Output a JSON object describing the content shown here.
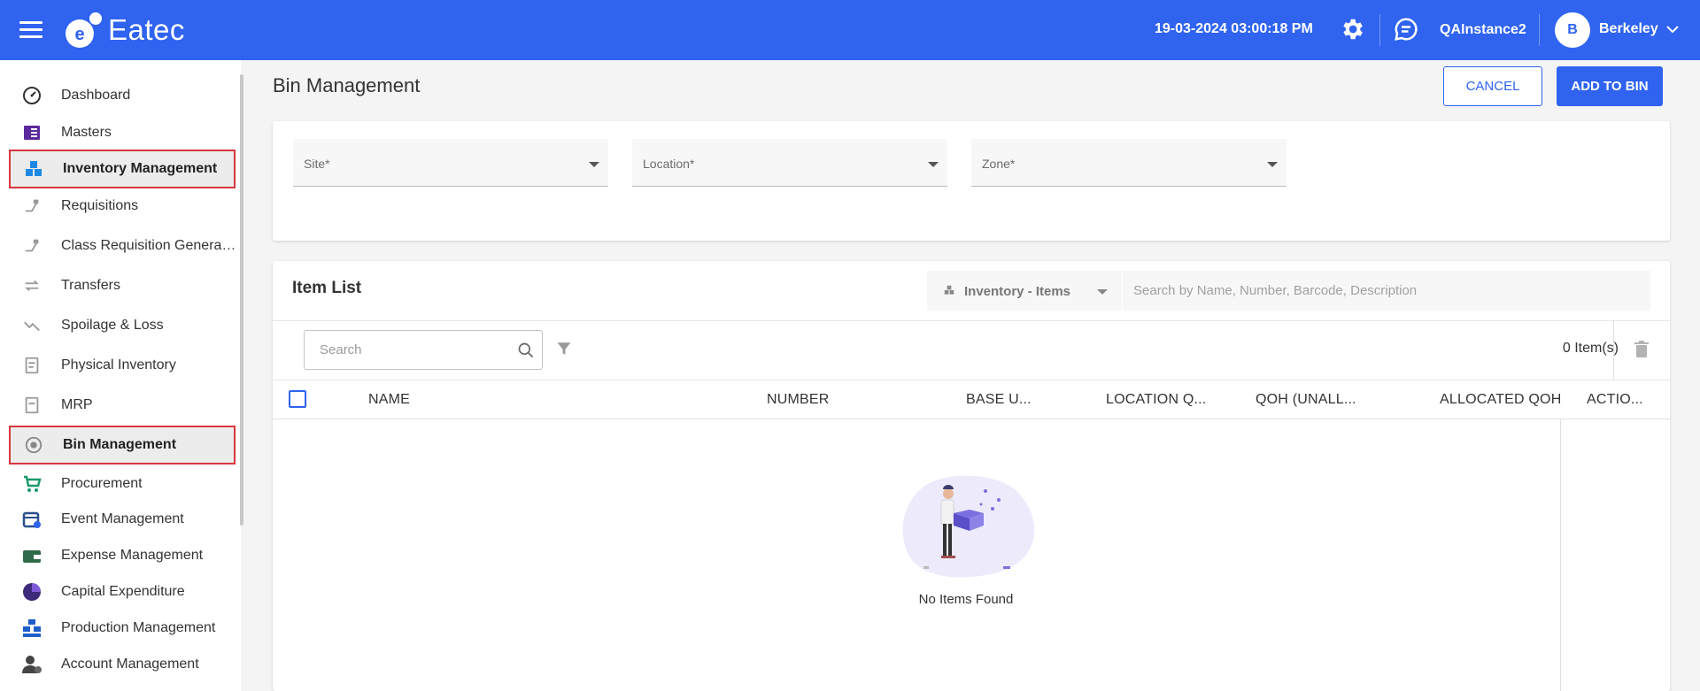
{
  "header": {
    "brand": "Eatec",
    "datetime": "19-03-2024 03:00:18 PM",
    "instance": "QAInstance2",
    "user_initial": "B",
    "user_name": "Berkeley"
  },
  "sidebar": {
    "items": [
      {
        "label": "Dashboard",
        "icon": "dashboard-icon"
      },
      {
        "label": "Masters",
        "icon": "book-icon"
      },
      {
        "label": "Inventory Management",
        "icon": "inventory-icon"
      },
      {
        "label": "Requisitions",
        "icon": "requisition-icon"
      },
      {
        "label": "Class Requisition Generation",
        "icon": "requisition-icon"
      },
      {
        "label": "Transfers",
        "icon": "transfer-icon"
      },
      {
        "label": "Spoilage & Loss",
        "icon": "spoilage-icon"
      },
      {
        "label": "Physical Inventory",
        "icon": "physical-inventory-icon"
      },
      {
        "label": "MRP",
        "icon": "mrp-icon"
      },
      {
        "label": "Bin Management",
        "icon": "bin-icon"
      },
      {
        "label": "Procurement",
        "icon": "cart-icon"
      },
      {
        "label": "Event Management",
        "icon": "calendar-icon"
      },
      {
        "label": "Expense Management",
        "icon": "wallet-icon"
      },
      {
        "label": "Capital Expenditure",
        "icon": "pie-icon"
      },
      {
        "label": "Production Management",
        "icon": "production-icon"
      },
      {
        "label": "Account Management",
        "icon": "account-icon"
      }
    ]
  },
  "page": {
    "title": "Bin Management",
    "cancel_label": "CANCEL",
    "add_label": "ADD TO BIN"
  },
  "filters": {
    "site_label": "Site*",
    "location_label": "Location*",
    "zone_label": "Zone*"
  },
  "item_list": {
    "title": "Item List",
    "inventory_select": "Inventory - Items",
    "search_placeholder": "Search by Name, Number, Barcode, Description",
    "table_search_placeholder": "Search",
    "count_text": "0 Item(s)",
    "columns": [
      "NAME",
      "NUMBER",
      "BASE U...",
      "LOCATION Q...",
      "QOH (UNALL...",
      "ALLOCATED QOH",
      "ACTIO..."
    ],
    "empty_text": "No Items Found"
  },
  "colors": {
    "primary": "#2f63f0",
    "highlight_border": "#d9363e"
  }
}
